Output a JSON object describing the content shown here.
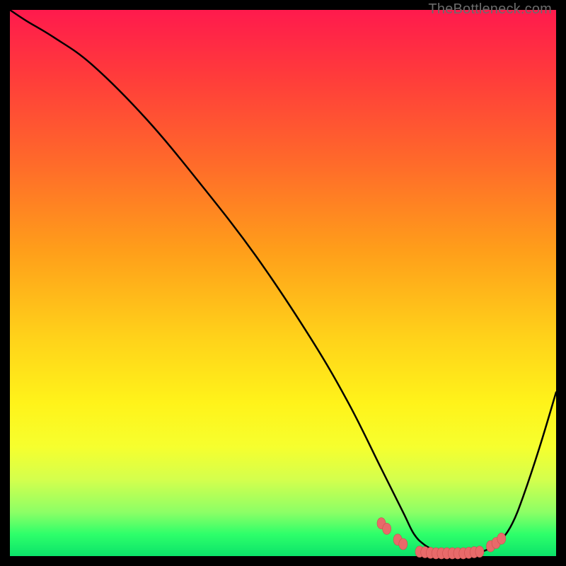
{
  "watermark": "TheBottleneck.com",
  "colors": {
    "curve_stroke": "#000000",
    "marker_fill": "#e86a6a",
    "marker_stroke": "#c94f4f"
  },
  "chart_data": {
    "type": "line",
    "title": "",
    "xlabel": "",
    "ylabel": "",
    "xlim": [
      0,
      100
    ],
    "ylim": [
      0,
      100
    ],
    "grid": false,
    "legend": false,
    "series": [
      {
        "name": "bottleneck-curve",
        "x": [
          0,
          3,
          8,
          15,
          25,
          35,
          45,
          55,
          62,
          68,
          72,
          74,
          76,
          78,
          80,
          82,
          84,
          86,
          88,
          90,
          92,
          94,
          97,
          100
        ],
        "y": [
          100,
          98,
          95,
          90,
          80,
          68,
          55,
          40,
          28,
          16,
          8,
          4,
          2,
          1,
          0.5,
          0.5,
          0.5,
          0.7,
          1.5,
          3,
          6,
          11,
          20,
          30
        ]
      }
    ],
    "markers": [
      {
        "x": 68,
        "y": 6.0
      },
      {
        "x": 69,
        "y": 5.0
      },
      {
        "x": 71,
        "y": 3.0
      },
      {
        "x": 72,
        "y": 2.2
      },
      {
        "x": 75,
        "y": 0.8
      },
      {
        "x": 76,
        "y": 0.7
      },
      {
        "x": 77,
        "y": 0.6
      },
      {
        "x": 78,
        "y": 0.5
      },
      {
        "x": 79,
        "y": 0.5
      },
      {
        "x": 80,
        "y": 0.5
      },
      {
        "x": 81,
        "y": 0.5
      },
      {
        "x": 82,
        "y": 0.5
      },
      {
        "x": 83,
        "y": 0.5
      },
      {
        "x": 84,
        "y": 0.6
      },
      {
        "x": 85,
        "y": 0.7
      },
      {
        "x": 86,
        "y": 0.8
      },
      {
        "x": 88,
        "y": 1.8
      },
      {
        "x": 89,
        "y": 2.4
      },
      {
        "x": 90,
        "y": 3.2
      }
    ]
  }
}
